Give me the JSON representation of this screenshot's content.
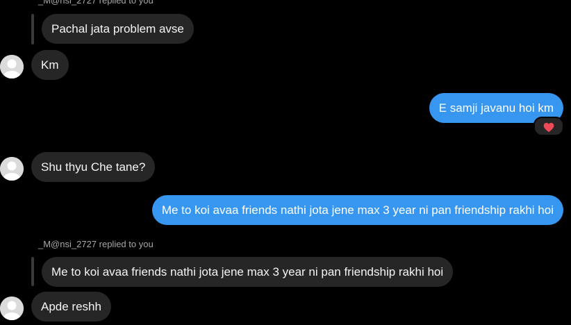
{
  "colors": {
    "background": "#000000",
    "incoming_bubble": "#262626",
    "outgoing_bubble": "#3797f0",
    "meta_text": "#a8a8a8",
    "heart": "#ed4956"
  },
  "messages": [
    {
      "kind": "reply_meta",
      "text": "_M@nsi_2727 replied to you"
    },
    {
      "kind": "quoted",
      "text": "Pachal jata problem avse"
    },
    {
      "kind": "incoming",
      "text": "Km",
      "avatar_icon": "default-avatar-icon"
    },
    {
      "kind": "outgoing",
      "text": "E samji javanu hoi km",
      "reaction": "heart-icon"
    },
    {
      "kind": "incoming",
      "text": "Shu thyu Che tane?",
      "avatar_icon": "default-avatar-icon"
    },
    {
      "kind": "outgoing",
      "text": "Me to koi avaa friends nathi jota jene max 3 year ni pan friendship rakhi hoi"
    },
    {
      "kind": "reply_meta",
      "text": "_M@nsi_2727 replied to you"
    },
    {
      "kind": "quoted",
      "text": "Me to koi avaa friends nathi jota jene max 3 year ni pan friendship rakhi hoi"
    },
    {
      "kind": "incoming",
      "text": "Apde reshh",
      "avatar_icon": "default-avatar-icon"
    }
  ]
}
